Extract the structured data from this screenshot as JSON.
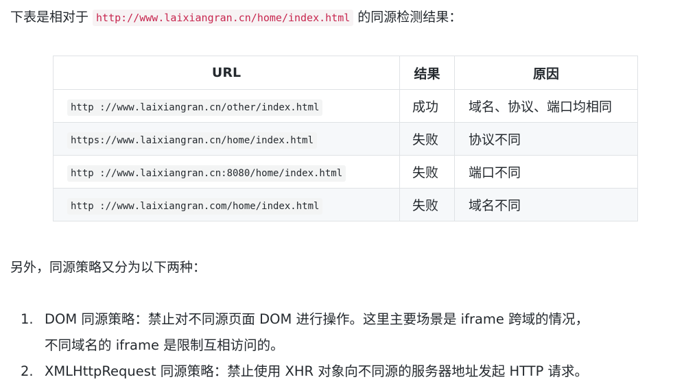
{
  "intro": {
    "prefix": "下表是相对于",
    "url": "http://www.laixiangran.cn/home/index.html",
    "suffix": "的同源检测结果："
  },
  "table": {
    "headers": [
      "URL",
      "结果",
      "原因"
    ],
    "rows": [
      {
        "url": "http ://www.laixiangran.cn/other/index.html",
        "result": "成功",
        "reason": "域名、协议、端口均相同"
      },
      {
        "url": "https://www.laixiangran.cn/home/index.html",
        "result": "失败",
        "reason": "协议不同"
      },
      {
        "url": "http ://www.laixiangran.cn:8080/home/index.html",
        "result": "失败",
        "reason": "端口不同"
      },
      {
        "url": "http ://www.laixiangran.com/home/index.html",
        "result": "失败",
        "reason": "域名不同"
      }
    ]
  },
  "para2": "另外，同源策略又分为以下两种：",
  "list": [
    {
      "num": "1.",
      "line1": "DOM 同源策略：禁止对不同源页面 DOM 进行操作。这里主要场景是 iframe 跨域的情况，",
      "line2": "不同域名的 iframe 是限制互相访问的。"
    },
    {
      "num": "2.",
      "line1": "XMLHttpRequest 同源策略：禁止使用 XHR 对象向不同源的服务器地址发起 HTTP 请求。"
    }
  ]
}
